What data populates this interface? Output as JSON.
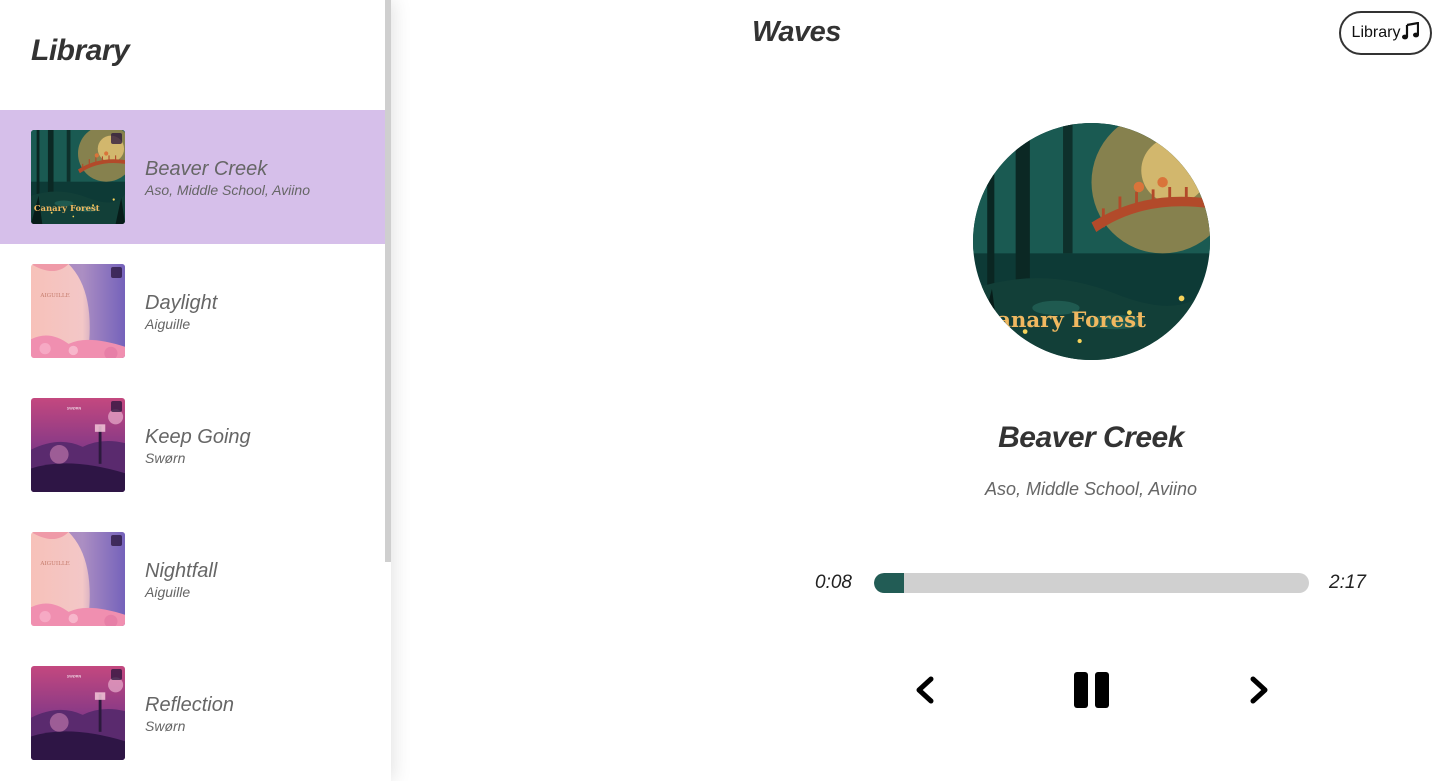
{
  "app": {
    "title": "Waves",
    "library_button_label": "Library"
  },
  "sidebar": {
    "title": "Library",
    "songs": [
      {
        "name": "Beaver Creek",
        "artist": "Aso, Middle School, Aviino",
        "active": true,
        "cover": "canary-forest"
      },
      {
        "name": "Daylight",
        "artist": "Aiguille",
        "active": false,
        "cover": "pink-sky"
      },
      {
        "name": "Keep Going",
        "artist": "Swørn",
        "active": false,
        "cover": "purple-lantern"
      },
      {
        "name": "Nightfall",
        "artist": "Aiguille",
        "active": false,
        "cover": "pink-sky"
      },
      {
        "name": "Reflection",
        "artist": "Swørn",
        "active": false,
        "cover": "purple-lantern"
      }
    ]
  },
  "player": {
    "title": "Beaver Creek",
    "artist": "Aso, Middle School, Aviino",
    "current_time": "0:08",
    "duration": "2:17",
    "progress_fraction": 0.07
  },
  "colors": {
    "active_row": "#d6bfea",
    "progress_fill": "#225c55",
    "progress_track": "#d0d0d0"
  },
  "icons": {
    "library": "music-note-icon",
    "prev": "chevron-left-icon",
    "pause": "pause-icon",
    "next": "chevron-right-icon"
  }
}
